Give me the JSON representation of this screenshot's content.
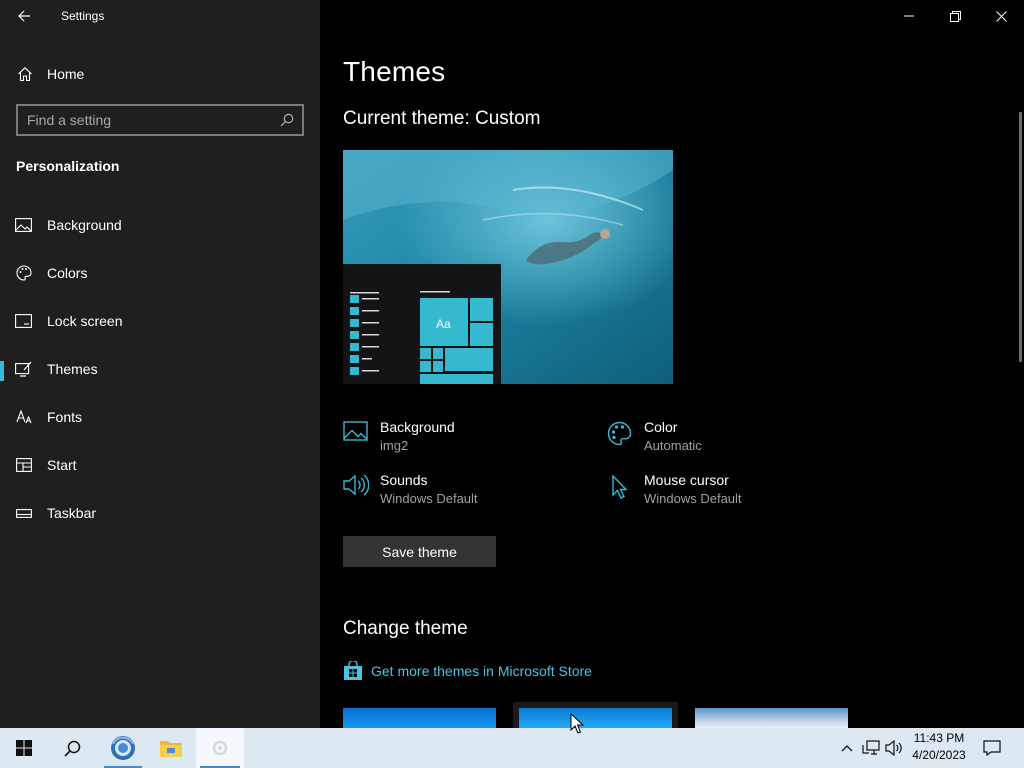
{
  "window": {
    "title": "Settings"
  },
  "sidebar": {
    "home_label": "Home",
    "search_placeholder": "Find a setting",
    "section_title": "Personalization",
    "items": [
      {
        "label": "Background",
        "icon": "picture-icon"
      },
      {
        "label": "Colors",
        "icon": "palette-icon"
      },
      {
        "label": "Lock screen",
        "icon": "lock-screen-icon"
      },
      {
        "label": "Themes",
        "icon": "brush-icon",
        "selected": true
      },
      {
        "label": "Fonts",
        "icon": "font-icon"
      },
      {
        "label": "Start",
        "icon": "start-icon"
      },
      {
        "label": "Taskbar",
        "icon": "taskbar-icon"
      }
    ]
  },
  "main": {
    "page_title": "Themes",
    "current_theme": "Current theme: Custom",
    "preview_tile_text": "Aa",
    "settings": {
      "background": {
        "name": "Background",
        "value": "img2"
      },
      "color": {
        "name": "Color",
        "value": "Automatic"
      },
      "sounds": {
        "name": "Sounds",
        "value": "Windows Default"
      },
      "mouse_cursor": {
        "name": "Mouse cursor",
        "value": "Windows Default"
      }
    },
    "save_theme_label": "Save theme",
    "change_theme_title": "Change theme",
    "store_link": "Get more themes in Microsoft Store"
  },
  "taskbar": {
    "time": "11:43 PM",
    "date": "4/20/2023"
  },
  "colors": {
    "accent": "#3ab7d4",
    "link": "#4cc2e0",
    "sidebar_bg": "#1f1f1f",
    "content_bg": "#000000",
    "taskbar_bg": "#dce8f2"
  }
}
